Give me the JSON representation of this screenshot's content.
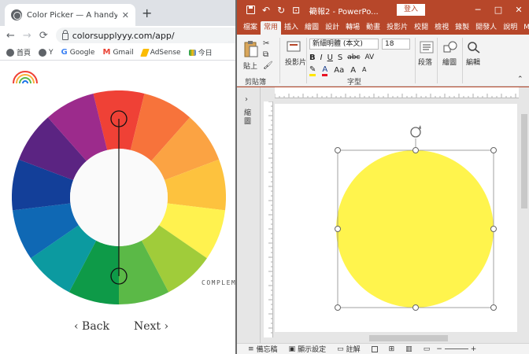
{
  "browser": {
    "tab_title": "Color Picker — A handy design",
    "tab_close": "✕",
    "new_tab": "+",
    "nav": {
      "back": "←",
      "forward": "→",
      "reload": "⟳"
    },
    "url": "colorsupplyyy.com/app/",
    "bookmarks": [
      {
        "label": "首頁",
        "icon": "globe-icon"
      },
      {
        "label": "Y",
        "icon": "globe-icon"
      },
      {
        "label": "Google",
        "icon": "google-icon"
      },
      {
        "label": "Gmail",
        "icon": "gmail-icon"
      },
      {
        "label": "AdSense",
        "icon": "adsense-icon"
      },
      {
        "label": "今日",
        "icon": "drive-icon"
      }
    ]
  },
  "app": {
    "logo_icon": "rainbow-logo-icon",
    "wheel_colors": [
      "#ef4136",
      "#f7733b",
      "#fba343",
      "#fdc23e",
      "#fff24f",
      "#a0cc3a",
      "#5bb947",
      "#0e9a48",
      "#0c9aa0",
      "#0f68b4",
      "#133f99",
      "#5b2482",
      "#9c2b8c"
    ],
    "selected_top_color": "#ef4136",
    "selected_bottom_color": "#0e9a48",
    "complement_label": "COMPLEME",
    "back_label": "‹ Back",
    "next_label": "Next ›"
  },
  "ppt": {
    "title": "簡報2 - PowerPo...",
    "login": "登入",
    "window_controls": [
      "─",
      "□",
      "✕"
    ],
    "tabs": [
      "檔案",
      "常用",
      "插入",
      "繪圖",
      "設計",
      "轉場",
      "動畫",
      "投影片",
      "校閱",
      "檢視",
      "錄製",
      "開發人",
      "說明",
      "Mix"
    ],
    "active_tab": "常用",
    "ribbon": {
      "paste": "貼上",
      "slides": "投影片",
      "font_name": "新細明體 (本文)",
      "font_size": "18",
      "format_row1": [
        "B",
        "I",
        "U",
        "S",
        "abc",
        "AV"
      ],
      "format_row2": [
        "A",
        "Aa",
        "A",
        "A"
      ],
      "paragraph": "段落",
      "drawing": "繪圖",
      "editing": "編輯",
      "group_clipboard": "剪貼簿",
      "group_font": "字型"
    },
    "left_pane": {
      "chevron": "›",
      "label": "縮圖"
    },
    "shape_fill": "#fff44d",
    "status": {
      "notes": "備忘稿",
      "display": "顯示設定",
      "comments": "註解"
    }
  }
}
